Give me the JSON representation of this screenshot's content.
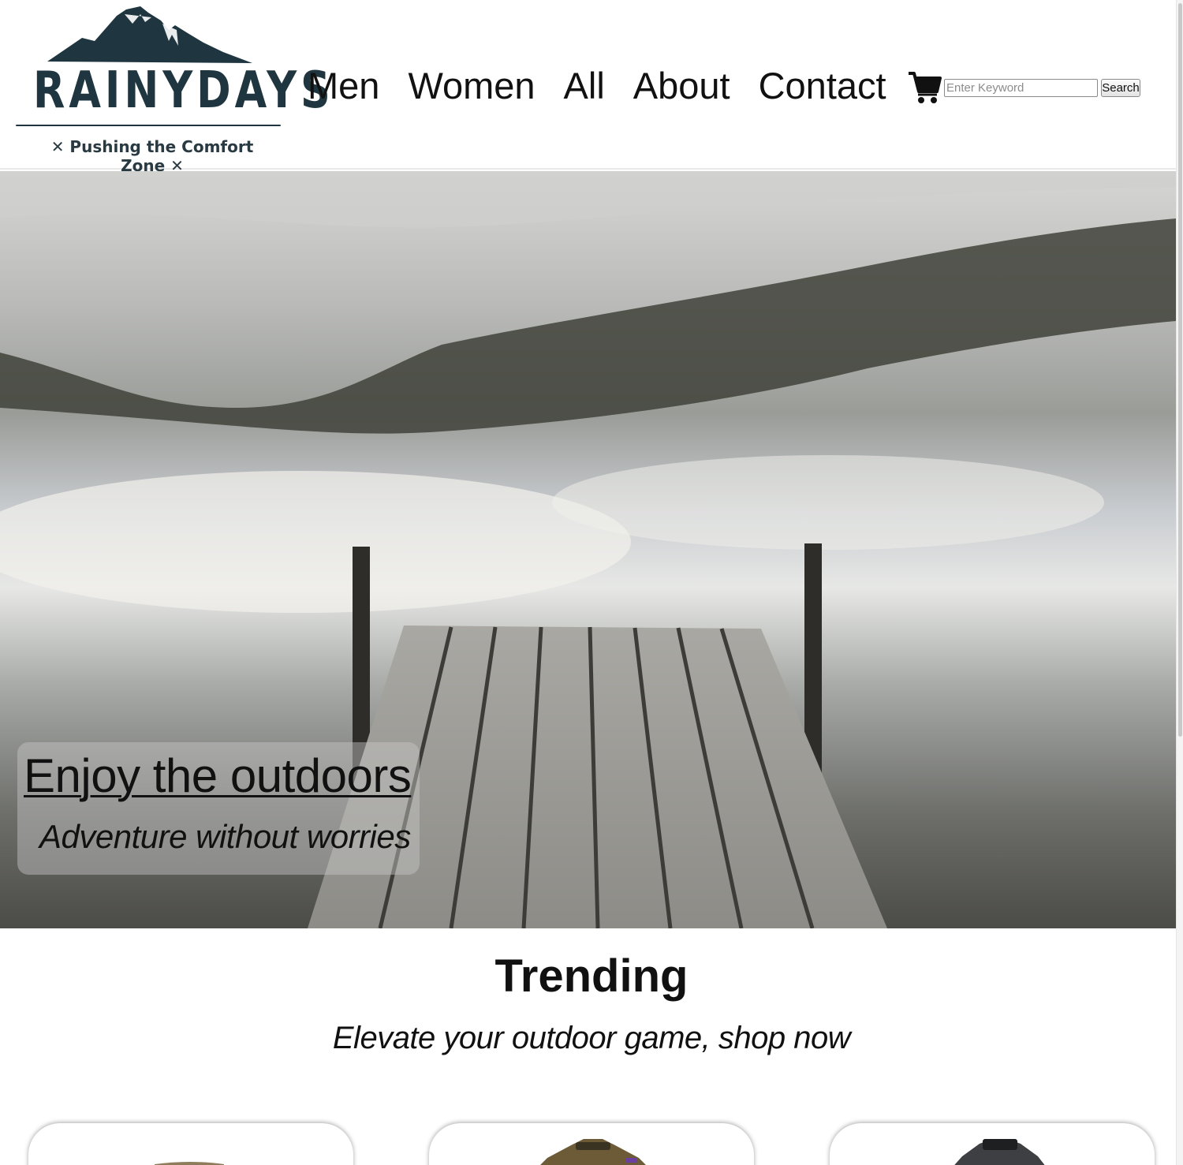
{
  "brand": {
    "name": "RAINYDAYS",
    "tagline": "Pushing the Comfort Zone",
    "color": "#1f3640"
  },
  "nav": {
    "items": [
      {
        "label": "Men"
      },
      {
        "label": "Women"
      },
      {
        "label": "All"
      },
      {
        "label": "About"
      },
      {
        "label": "Contact"
      }
    ],
    "cart_icon": "cart-icon"
  },
  "search": {
    "placeholder": "Enter Keyword",
    "value": "",
    "button_label": "Search"
  },
  "hero": {
    "title": "Enjoy the outdoors",
    "subtitle": "Adventure without worries"
  },
  "trending": {
    "title": "Trending",
    "subtitle": "Elevate your outdoor game, shop now",
    "cards": [
      {
        "name": "product-card-1"
      },
      {
        "name": "product-card-2"
      },
      {
        "name": "product-card-3"
      }
    ]
  }
}
